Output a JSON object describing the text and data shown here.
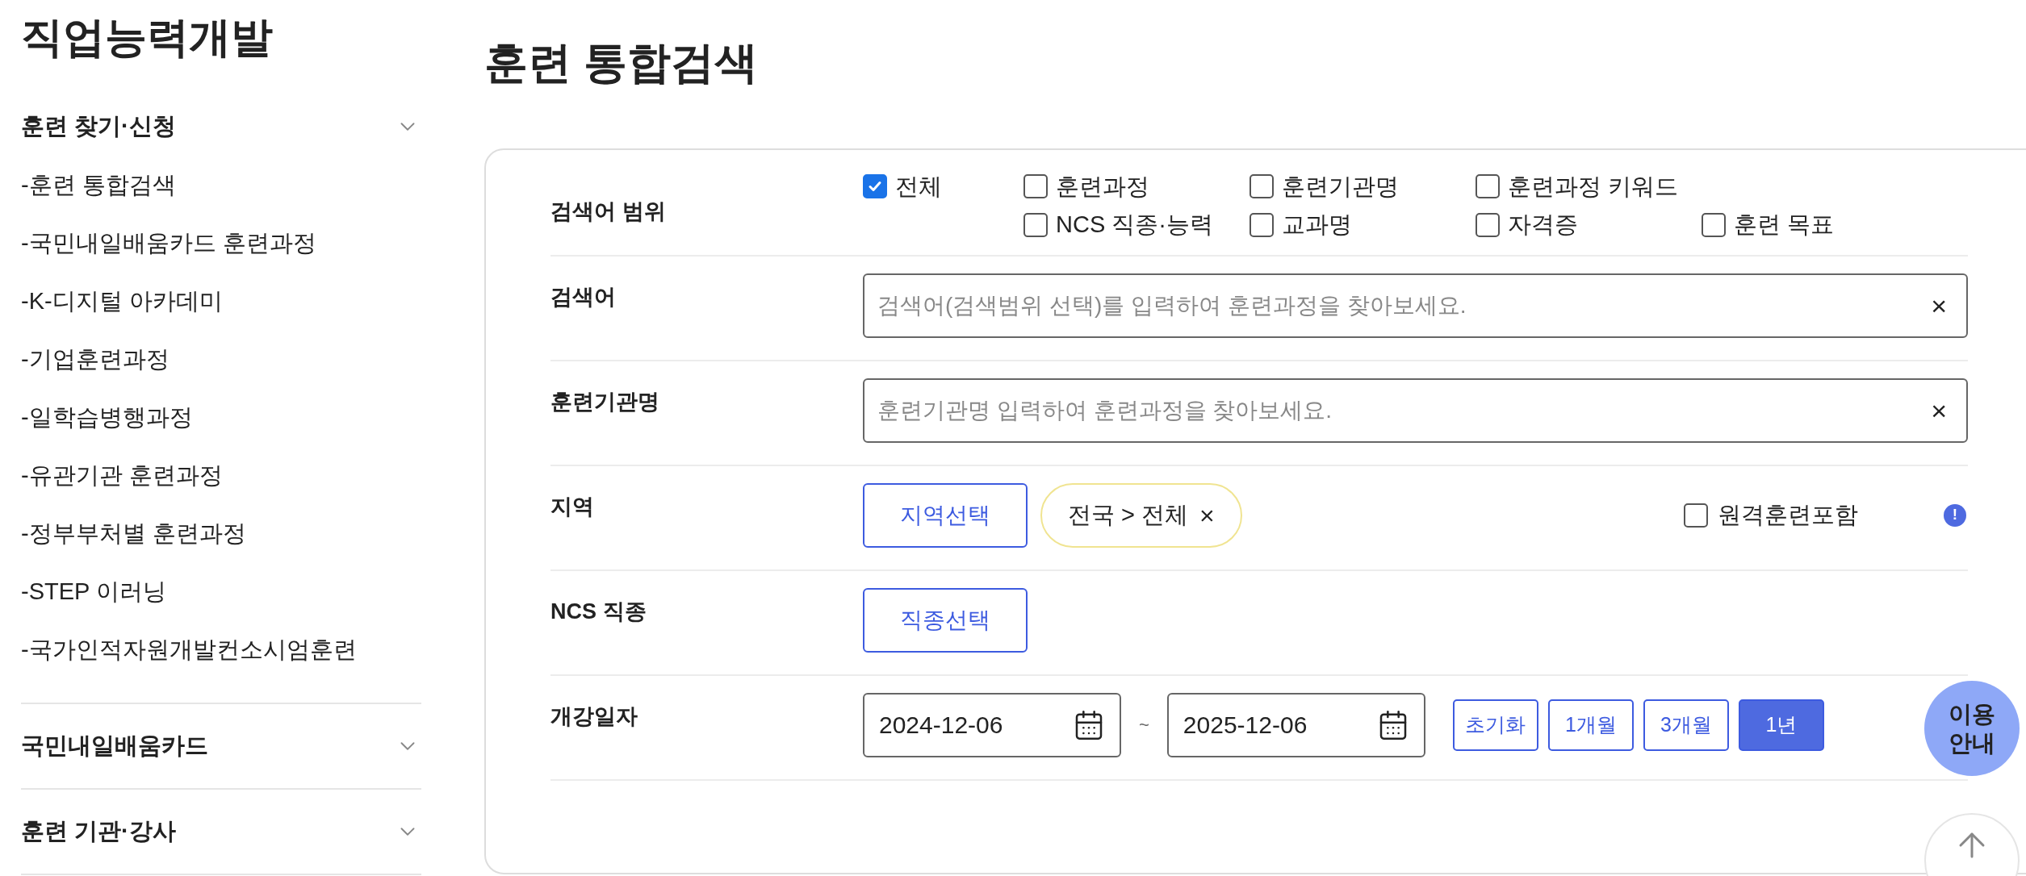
{
  "sidebar": {
    "title": "직업능력개발",
    "groups": [
      {
        "label": "훈련 찾기·신청",
        "expanded": true,
        "items": [
          "-훈련 통합검색",
          "-국민내일배움카드 훈련과정",
          "-K-디지털 아카데미",
          "-기업훈련과정",
          "-일학습병행과정",
          "-유관기관 훈련과정",
          "-정부부처별 훈련과정",
          "-STEP 이러닝",
          "-국가인적자원개발컨소시엄훈련"
        ]
      },
      {
        "label": "국민내일배움카드",
        "expanded": false
      },
      {
        "label": "훈련 기관·강사",
        "expanded": false
      }
    ]
  },
  "main": {
    "title": "훈련 통합검색",
    "scope": {
      "label": "검색어 범위",
      "options": [
        {
          "label": "전체",
          "checked": true
        },
        {
          "label": "훈련과정",
          "checked": false
        },
        {
          "label": "훈련기관명",
          "checked": false
        },
        {
          "label": "훈련과정 키워드",
          "checked": false
        },
        {
          "label": "NCS 직종·능력",
          "checked": false
        },
        {
          "label": "교과명",
          "checked": false
        },
        {
          "label": "자격증",
          "checked": false
        },
        {
          "label": "훈련 목표",
          "checked": false
        }
      ]
    },
    "keyword": {
      "label": "검색어",
      "placeholder": "검색어(검색범위 선택)를 입력하여 훈련과정을 찾아보세요.",
      "clear": "×"
    },
    "institution": {
      "label": "훈련기관명",
      "placeholder": "훈련기관명 입력하여 훈련과정을 찾아보세요.",
      "clear": "×"
    },
    "region": {
      "label": "지역",
      "button": "지역선택",
      "chip": "전국 > 전체",
      "chip_remove": "×",
      "remote": {
        "label": "원격훈련포함",
        "checked": false
      },
      "info": "!"
    },
    "ncs": {
      "label": "NCS 직종",
      "button": "직종선택"
    },
    "date": {
      "label": "개강일자",
      "from": "2024-12-06",
      "separator": "~",
      "to": "2025-12-06",
      "periods": [
        {
          "label": "초기화",
          "selected": false
        },
        {
          "label": "1개월",
          "selected": false
        },
        {
          "label": "3개월",
          "selected": false
        },
        {
          "label": "1년",
          "selected": true
        }
      ]
    }
  },
  "floating": {
    "guide": "이용 안내"
  }
}
